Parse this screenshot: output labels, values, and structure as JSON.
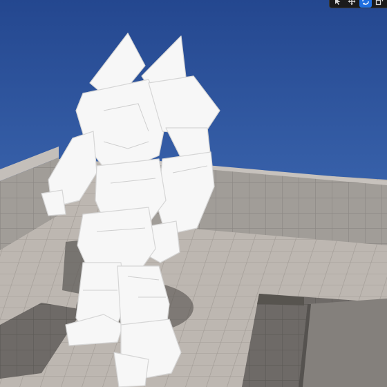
{
  "viewport": {
    "sky_color": "#2a4f9a",
    "floor_color": "#b9b3ad",
    "wall_color": "#9c9893",
    "model_color": "#f7f7f7"
  },
  "toolbar": {
    "buttons": [
      {
        "icon": "select-cursor-icon",
        "active": false
      },
      {
        "icon": "move-arrows-icon",
        "active": false
      },
      {
        "icon": "rotate-arrows-icon",
        "active": true
      }
    ]
  }
}
